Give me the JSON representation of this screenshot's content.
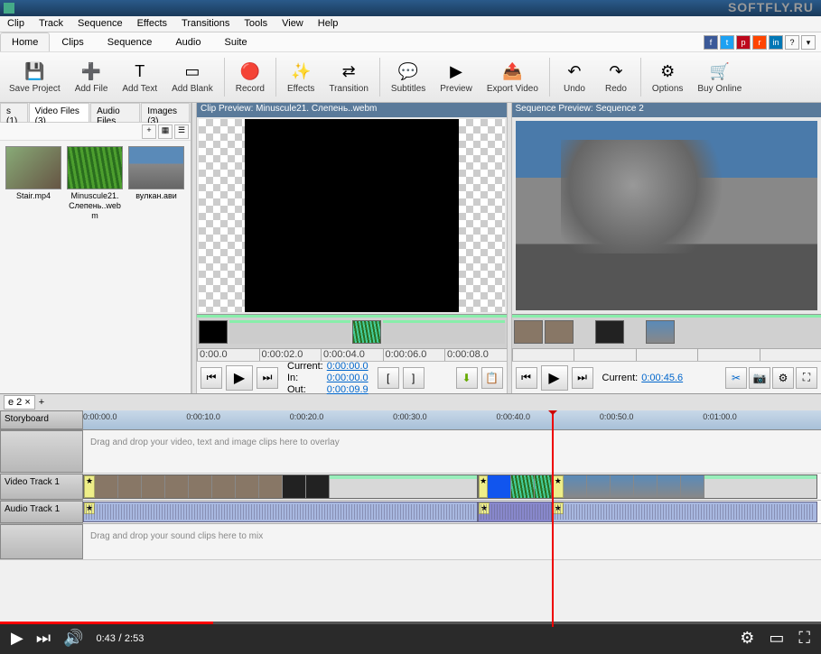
{
  "watermark": "SOFTFLY.RU",
  "menu": [
    "Clip",
    "Track",
    "Sequence",
    "Effects",
    "Transitions",
    "Tools",
    "View",
    "Help"
  ],
  "ribbon_tabs": [
    "Home",
    "Clips",
    "Sequence",
    "Audio",
    "Suite"
  ],
  "active_ribbon_tab": 0,
  "toolbar": [
    {
      "icon": "💾",
      "label": "Save Project"
    },
    {
      "icon": "➕",
      "label": "Add File"
    },
    {
      "icon": "T",
      "label": "Add Text"
    },
    {
      "icon": "▭",
      "label": "Add Blank"
    },
    {
      "sep": true
    },
    {
      "icon": "🔴",
      "label": "Record"
    },
    {
      "sep": true
    },
    {
      "icon": "✨",
      "label": "Effects"
    },
    {
      "icon": "⇄",
      "label": "Transition"
    },
    {
      "sep": true
    },
    {
      "icon": "💬",
      "label": "Subtitles"
    },
    {
      "icon": "▶",
      "label": "Preview"
    },
    {
      "icon": "📤",
      "label": "Export Video"
    },
    {
      "sep": true
    },
    {
      "icon": "↶",
      "label": "Undo"
    },
    {
      "icon": "↷",
      "label": "Redo"
    },
    {
      "sep": true
    },
    {
      "icon": "⚙",
      "label": "Options"
    },
    {
      "icon": "🛒",
      "label": "Buy Online"
    }
  ],
  "media_tabs": [
    {
      "label": "s (1)"
    },
    {
      "label": "Video Files (3)",
      "active": true
    },
    {
      "label": "Audio Files"
    },
    {
      "label": "Images (3)"
    }
  ],
  "media_items": [
    {
      "name": "Stair.mp4",
      "cls": "stair"
    },
    {
      "name": "Minuscule21. Слепень..webm",
      "cls": "grass"
    },
    {
      "name": "вулкан.ави",
      "cls": "volcano"
    }
  ],
  "clip_preview": {
    "title": "Clip Preview: Minuscule21. Слепень..webm",
    "current_label": "Current:",
    "current": "0:00:00.0",
    "in_label": "In:",
    "in": "0:00:00.0",
    "out_label": "Out:",
    "out": "0:00:09.9",
    "ruler": [
      "0:00.0",
      "0:00:02.0",
      "0:00:04.0",
      "0:00:06.0",
      "0:00:08.0"
    ]
  },
  "seq_preview": {
    "title": "Sequence Preview: Sequence 2",
    "current_label": "Current:",
    "current": "0:00:45.6"
  },
  "timeline": {
    "tab": "e 2 ×",
    "storyboard": "Storyboard",
    "ticks": [
      {
        "t": "0:00:00.0",
        "p": 0
      },
      {
        "t": "0:00:10.0",
        "p": 14
      },
      {
        "t": "0:00:20.0",
        "p": 28
      },
      {
        "t": "0:00:30.0",
        "p": 42
      },
      {
        "t": "0:00:40.0",
        "p": 56
      },
      {
        "t": "0:00:50.0",
        "p": 70
      },
      {
        "t": "0:01:00.0",
        "p": 84
      }
    ],
    "playhead_pct": 63.5,
    "overlay_hint": "Drag and drop your video, text and image clips here to overlay",
    "video_track_label": "Video Track 1",
    "audio_track_label": "Audio Track 1",
    "mix_hint": "Drag and drop your sound clips here to mix"
  },
  "video_player": {
    "progress_pct": 26,
    "current": "0:43",
    "duration": "2:53"
  }
}
